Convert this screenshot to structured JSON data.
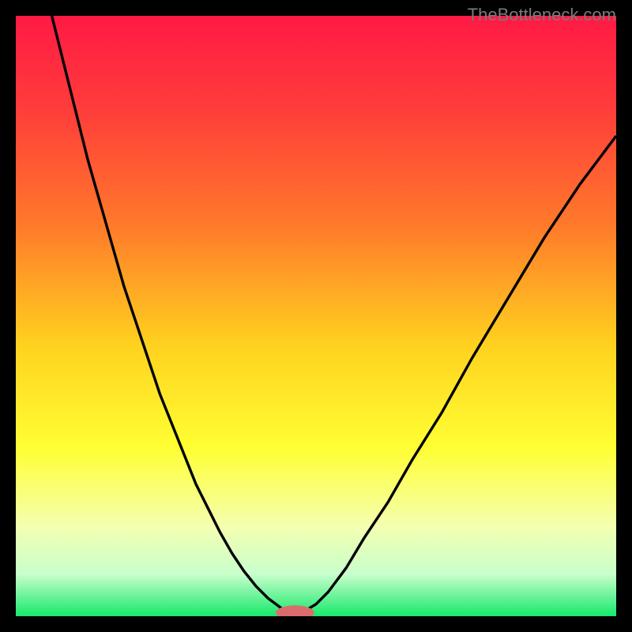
{
  "watermark": "TheBottleneck.com",
  "chart_data": {
    "type": "line",
    "title": "",
    "xlabel": "",
    "ylabel": "",
    "xlim": [
      0,
      100
    ],
    "ylim": [
      0,
      100
    ],
    "background_gradient": {
      "stops": [
        {
          "offset": 0.0,
          "color": "#ff1a44"
        },
        {
          "offset": 0.15,
          "color": "#ff3b3b"
        },
        {
          "offset": 0.35,
          "color": "#ff7a2a"
        },
        {
          "offset": 0.55,
          "color": "#ffd21f"
        },
        {
          "offset": 0.72,
          "color": "#ffff33"
        },
        {
          "offset": 0.85,
          "color": "#f4ffb0"
        },
        {
          "offset": 0.93,
          "color": "#c8ffcc"
        },
        {
          "offset": 1.0,
          "color": "#17e86b"
        }
      ]
    },
    "series": [
      {
        "name": "left-curve",
        "x": [
          6,
          8,
          10,
          12,
          14,
          16,
          18,
          20,
          22,
          24,
          26,
          28,
          30,
          32,
          34,
          36,
          38,
          40,
          42,
          44,
          45
        ],
        "y": [
          100,
          92,
          84,
          76,
          69,
          62,
          55,
          49,
          43,
          37,
          32,
          27,
          22,
          18,
          14,
          10.5,
          7.5,
          5,
          3,
          1.5,
          0.8
        ]
      },
      {
        "name": "right-curve",
        "x": [
          48,
          50,
          52,
          55,
          58,
          62,
          66,
          71,
          76,
          82,
          88,
          94,
          100
        ],
        "y": [
          0.8,
          2,
          4,
          8,
          13,
          19,
          26,
          34,
          43,
          53,
          63,
          72,
          80
        ]
      }
    ],
    "marker": {
      "x": 46.5,
      "y": 0.6,
      "color": "#d96d6d",
      "rx": 3.2,
      "ry": 1.2
    }
  }
}
